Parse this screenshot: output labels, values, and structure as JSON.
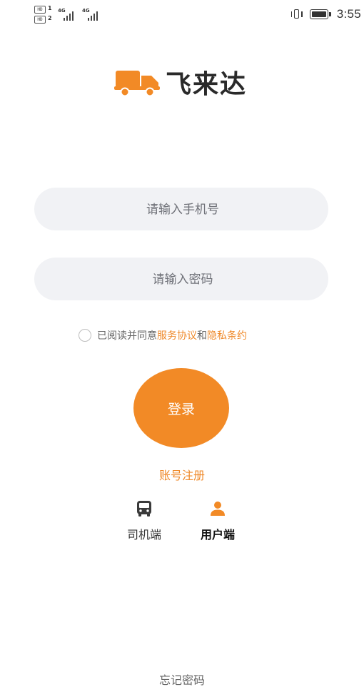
{
  "status_bar": {
    "sim1_tag": "HD",
    "sim1_num": "1",
    "sim2_tag": "HD",
    "sim2_num": "2",
    "network1": "4G",
    "network2": "4G",
    "time": "3:55"
  },
  "brand": {
    "name": "飞来达",
    "accent_color": "#f28a26",
    "icon": "truck-icon"
  },
  "login_form": {
    "phone_placeholder": "请输入手机号",
    "phone_value": "",
    "password_placeholder": "请输入密码",
    "password_value": ""
  },
  "agreement": {
    "prefix": "已阅读并同意",
    "service_link": "服务协议",
    "connector": "和",
    "privacy_link": "隐私条约",
    "checked": false
  },
  "actions": {
    "login_label": "登录",
    "register_label": "账号注册",
    "forgot_label": "忘记密码"
  },
  "roles": [
    {
      "label": "司机端",
      "icon": "bus-icon",
      "selected": false
    },
    {
      "label": "用户端",
      "icon": "user-icon",
      "selected": true
    }
  ]
}
